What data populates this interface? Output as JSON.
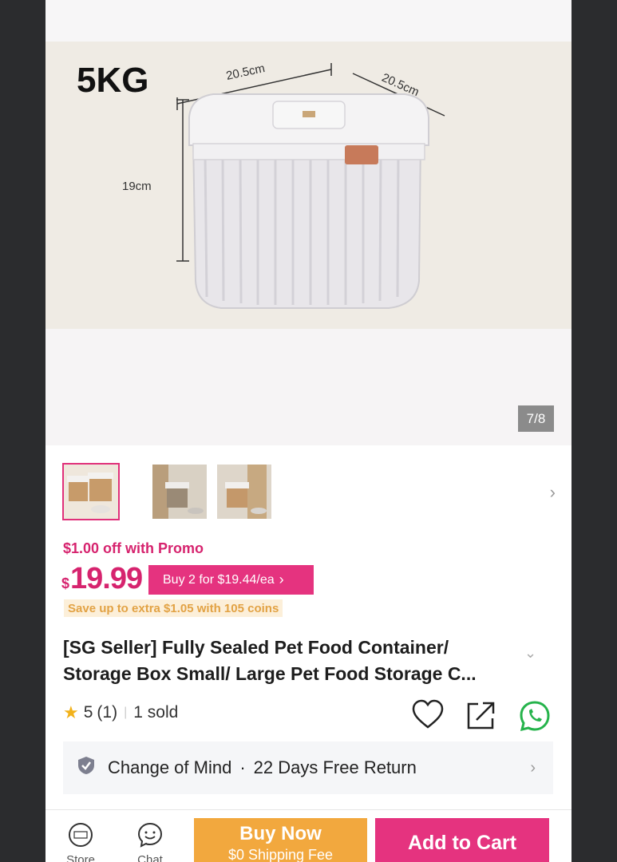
{
  "gallery": {
    "size_label": "5KG",
    "dim_width": "20.5cm",
    "dim_depth": "20.5cm",
    "dim_height": "19cm",
    "counter": "7/8"
  },
  "promo": {
    "text": "$1.00 off with Promo"
  },
  "price": {
    "currency": "$",
    "amount": "19.99",
    "bundle_label": "Buy 2 for $19.44/ea",
    "coins_text": "Save up to extra $1.05 with 105 coins"
  },
  "product": {
    "title": "[SG Seller] Fully Sealed Pet Food Container/ Storage Box Small/ Large Pet Food Storage C..."
  },
  "rating": {
    "score": "5",
    "count": "(1)",
    "sold": "1 sold"
  },
  "policy": {
    "name": "Change of Mind",
    "separator": "·",
    "detail": "22 Days Free Return"
  },
  "bottom_bar": {
    "store_label": "Store",
    "chat_label": "Chat",
    "buy_now_label": "Buy Now",
    "buy_now_sub": "$0 Shipping Fee",
    "add_to_cart_label": "Add to Cart"
  },
  "colors": {
    "brand_pink": "#e5337f",
    "coins_orange": "#f2a83e"
  }
}
